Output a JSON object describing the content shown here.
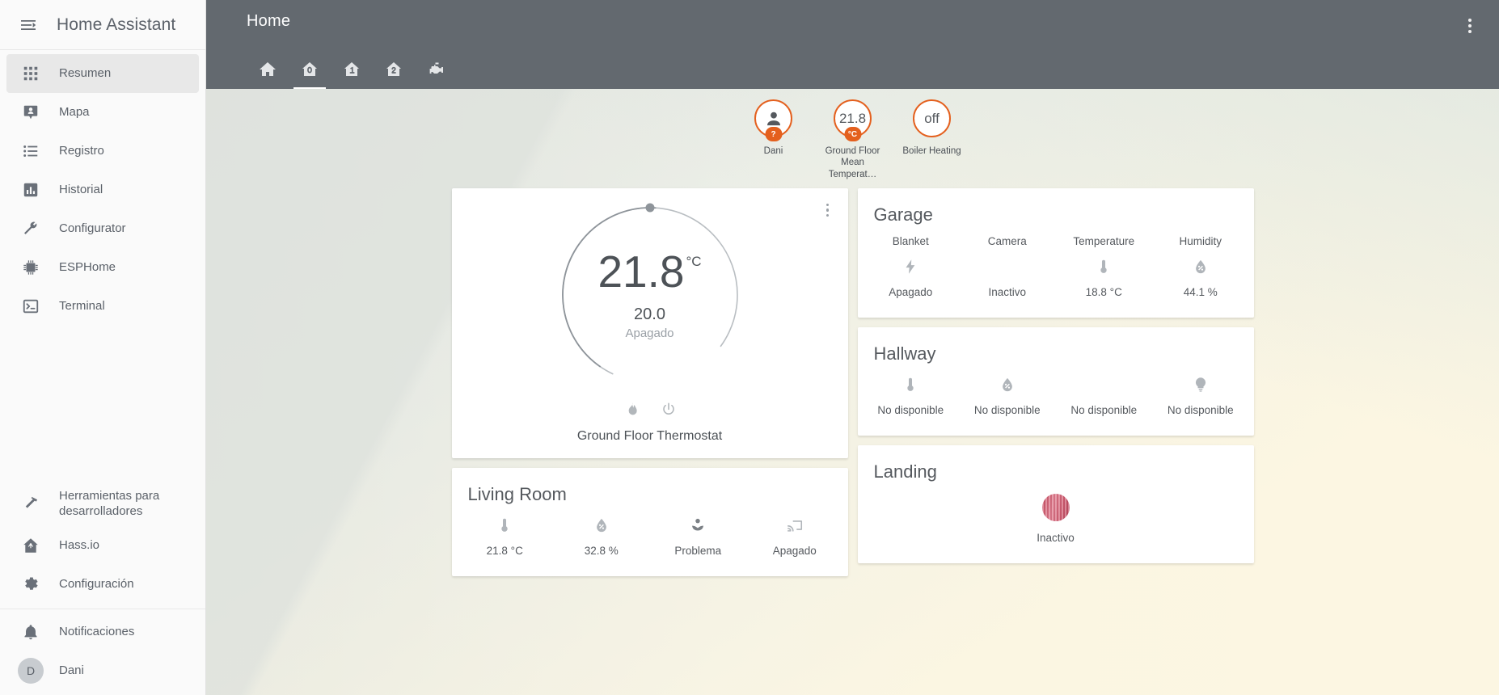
{
  "sidebar": {
    "title": "Home Assistant",
    "toggle_icon": "menu-collapse-icon",
    "items": [
      {
        "label": "Resumen",
        "icon": "apps-grid-icon",
        "active": true
      },
      {
        "label": "Mapa",
        "icon": "map-marker-account-icon",
        "active": false
      },
      {
        "label": "Registro",
        "icon": "format-list-icon",
        "active": false
      },
      {
        "label": "Historial",
        "icon": "chart-box-icon",
        "active": false
      },
      {
        "label": "Configurator",
        "icon": "wrench-icon",
        "active": false
      },
      {
        "label": "ESPHome",
        "icon": "chip-icon",
        "active": false
      },
      {
        "label": "Terminal",
        "icon": "console-icon",
        "active": false
      }
    ],
    "bottom_items": [
      {
        "label": "Herramientas para desarrolladores",
        "icon": "hammer-icon"
      },
      {
        "label": "Hass.io",
        "icon": "hassio-home-icon"
      },
      {
        "label": "Configuración",
        "icon": "cog-icon"
      }
    ],
    "footer_items": [
      {
        "label": "Notificaciones",
        "icon": "bell-icon"
      }
    ],
    "user": {
      "label": "Dani",
      "initial": "D"
    }
  },
  "toolbar": {
    "title": "Home",
    "overflow_icon": "dots-vertical-icon",
    "tabs": [
      {
        "icon": "home-icon",
        "name": "tab-home",
        "active": false
      },
      {
        "icon": "home-floor-0-icon",
        "name": "tab-floor-0",
        "active": true
      },
      {
        "icon": "home-floor-1-icon",
        "name": "tab-floor-1",
        "active": false
      },
      {
        "icon": "home-floor-2-icon",
        "name": "tab-floor-2",
        "active": false
      },
      {
        "icon": "engine-icon",
        "name": "tab-engine",
        "active": false
      }
    ]
  },
  "badges": [
    {
      "name": "Dani",
      "value": "",
      "icon": "account-icon",
      "sub": "?"
    },
    {
      "name": "Ground Floor Mean Temperat…",
      "value": "21.8",
      "icon": "",
      "sub": "°C"
    },
    {
      "name": "Boiler Heating",
      "value": "off",
      "icon": "",
      "sub": ""
    }
  ],
  "thermostat": {
    "temperature": "21.8",
    "unit": "°C",
    "target": "20.0",
    "state": "Apagado",
    "name": "Ground Floor Thermostat",
    "modes": [
      {
        "icon": "flame-icon",
        "name": "mode-heat"
      },
      {
        "icon": "power-icon",
        "name": "mode-off"
      }
    ]
  },
  "cards": {
    "living_room": {
      "title": "Living Room",
      "items": [
        {
          "head": "",
          "icon": "thermometer-icon",
          "value": "21.8 °C"
        },
        {
          "head": "",
          "icon": "water-percent-icon",
          "value": "32.8 %"
        },
        {
          "head": "",
          "icon": "flower-icon",
          "value": "Problema"
        },
        {
          "head": "",
          "icon": "cast-icon",
          "value": "Apagado"
        }
      ]
    },
    "garage": {
      "title": "Garage",
      "items": [
        {
          "head": "Blanket",
          "icon": "flash-icon",
          "value": "Apagado"
        },
        {
          "head": "Camera",
          "icon": "",
          "value": "Inactivo"
        },
        {
          "head": "Temperature",
          "icon": "thermometer-icon",
          "value": "18.8 °C"
        },
        {
          "head": "Humidity",
          "icon": "water-percent-icon",
          "value": "44.1 %"
        }
      ]
    },
    "hallway": {
      "title": "Hallway",
      "items": [
        {
          "head": "",
          "icon": "thermometer-icon",
          "value": "No disponible"
        },
        {
          "head": "",
          "icon": "water-percent-icon",
          "value": "No disponible"
        },
        {
          "head": "",
          "icon": "",
          "value": "No disponible"
        },
        {
          "head": "",
          "icon": "lightbulb-icon",
          "value": "No disponible"
        }
      ]
    },
    "landing": {
      "title": "Landing",
      "items": [
        {
          "head": "",
          "icon": "camera-thumbnail",
          "value": "Inactivo"
        }
      ]
    }
  },
  "colors": {
    "accent": "#e4601e",
    "toolbar": "#63696f",
    "text": "#55595e",
    "muted": "#9aa0a6"
  }
}
